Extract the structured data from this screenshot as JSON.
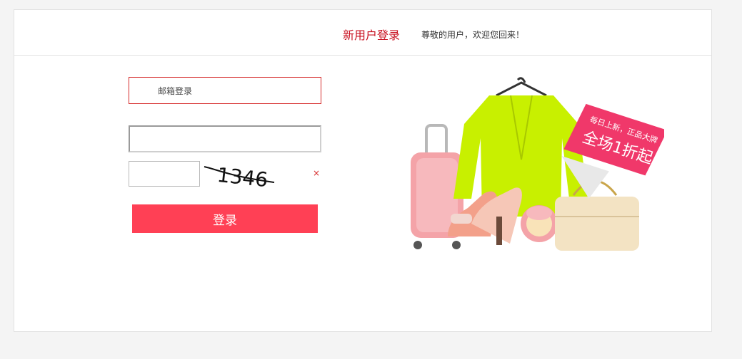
{
  "header": {
    "title": "新用户登录",
    "welcome": "尊敬的用户，欢迎您回来！"
  },
  "form": {
    "email_placeholder": "邮箱登录",
    "password_value": "",
    "captcha_value": "",
    "captcha_code": "1346",
    "captcha_error": "×",
    "login_label": "登录"
  },
  "promo": {
    "badge_line1": "每日上新，正品大牌",
    "badge_line2": "全场1折起"
  },
  "colors": {
    "accent": "#c8101f",
    "button": "#ff4055",
    "badge": "#f0386a",
    "sweater": "#c8f000"
  }
}
